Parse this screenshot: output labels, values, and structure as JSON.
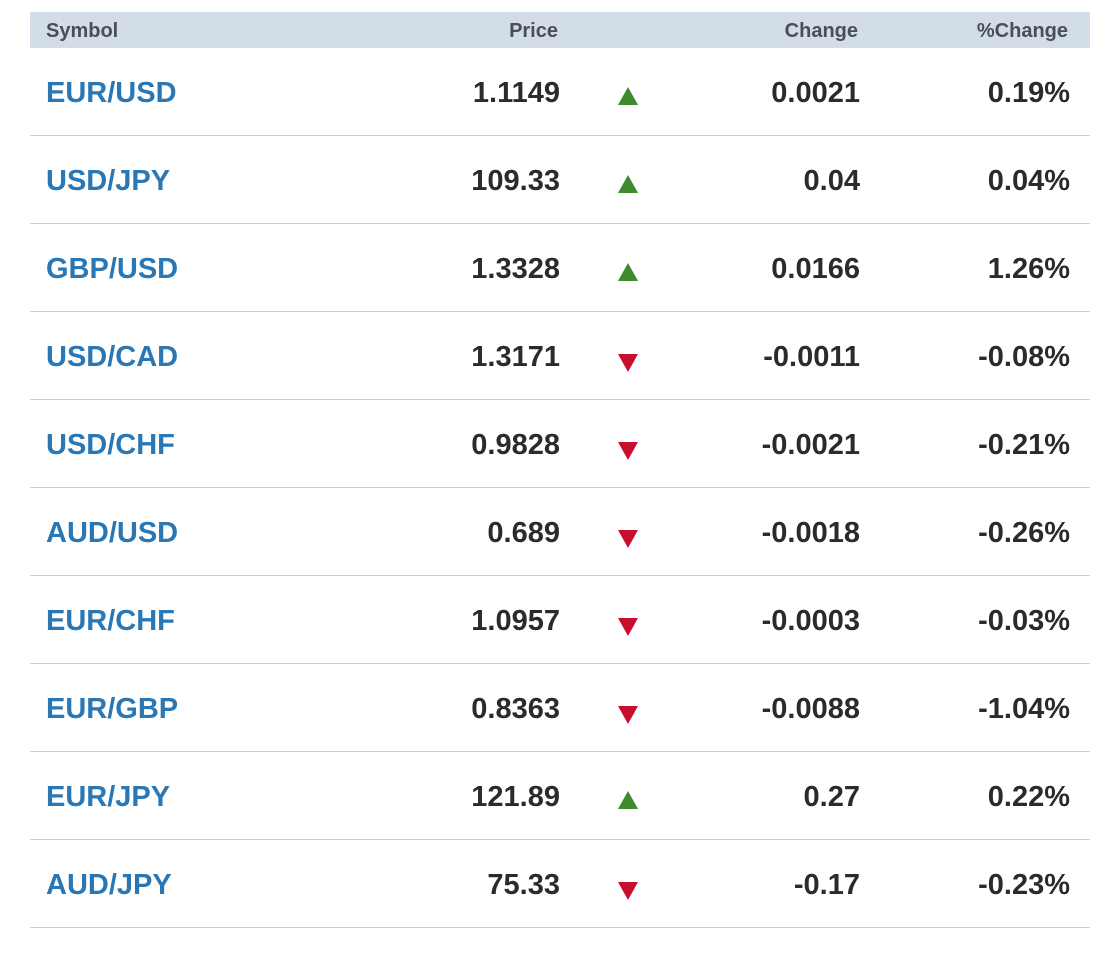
{
  "header": {
    "symbol": "Symbol",
    "price": "Price",
    "change": "Change",
    "pct_change": "%Change"
  },
  "colors": {
    "header_bg": "#d3dde7",
    "symbol_link": "#2a77b5",
    "up": "#3e8a2c",
    "down": "#c8102e",
    "divider": "#c7d1db"
  },
  "rows": [
    {
      "symbol": "EUR/USD",
      "price": "1.1149",
      "direction": "up",
      "change": "0.0021",
      "pct_change": "0.19%"
    },
    {
      "symbol": "USD/JPY",
      "price": "109.33",
      "direction": "up",
      "change": "0.04",
      "pct_change": "0.04%"
    },
    {
      "symbol": "GBP/USD",
      "price": "1.3328",
      "direction": "up",
      "change": "0.0166",
      "pct_change": "1.26%"
    },
    {
      "symbol": "USD/CAD",
      "price": "1.3171",
      "direction": "down",
      "change": "-0.0011",
      "pct_change": "-0.08%"
    },
    {
      "symbol": "USD/CHF",
      "price": "0.9828",
      "direction": "down",
      "change": "-0.0021",
      "pct_change": "-0.21%"
    },
    {
      "symbol": "AUD/USD",
      "price": "0.689",
      "direction": "down",
      "change": "-0.0018",
      "pct_change": "-0.26%"
    },
    {
      "symbol": "EUR/CHF",
      "price": "1.0957",
      "direction": "down",
      "change": "-0.0003",
      "pct_change": "-0.03%"
    },
    {
      "symbol": "EUR/GBP",
      "price": "0.8363",
      "direction": "down",
      "change": "-0.0088",
      "pct_change": "-1.04%"
    },
    {
      "symbol": "EUR/JPY",
      "price": "121.89",
      "direction": "up",
      "change": "0.27",
      "pct_change": "0.22%"
    },
    {
      "symbol": "AUD/JPY",
      "price": "75.33",
      "direction": "down",
      "change": "-0.17",
      "pct_change": "-0.23%"
    }
  ]
}
